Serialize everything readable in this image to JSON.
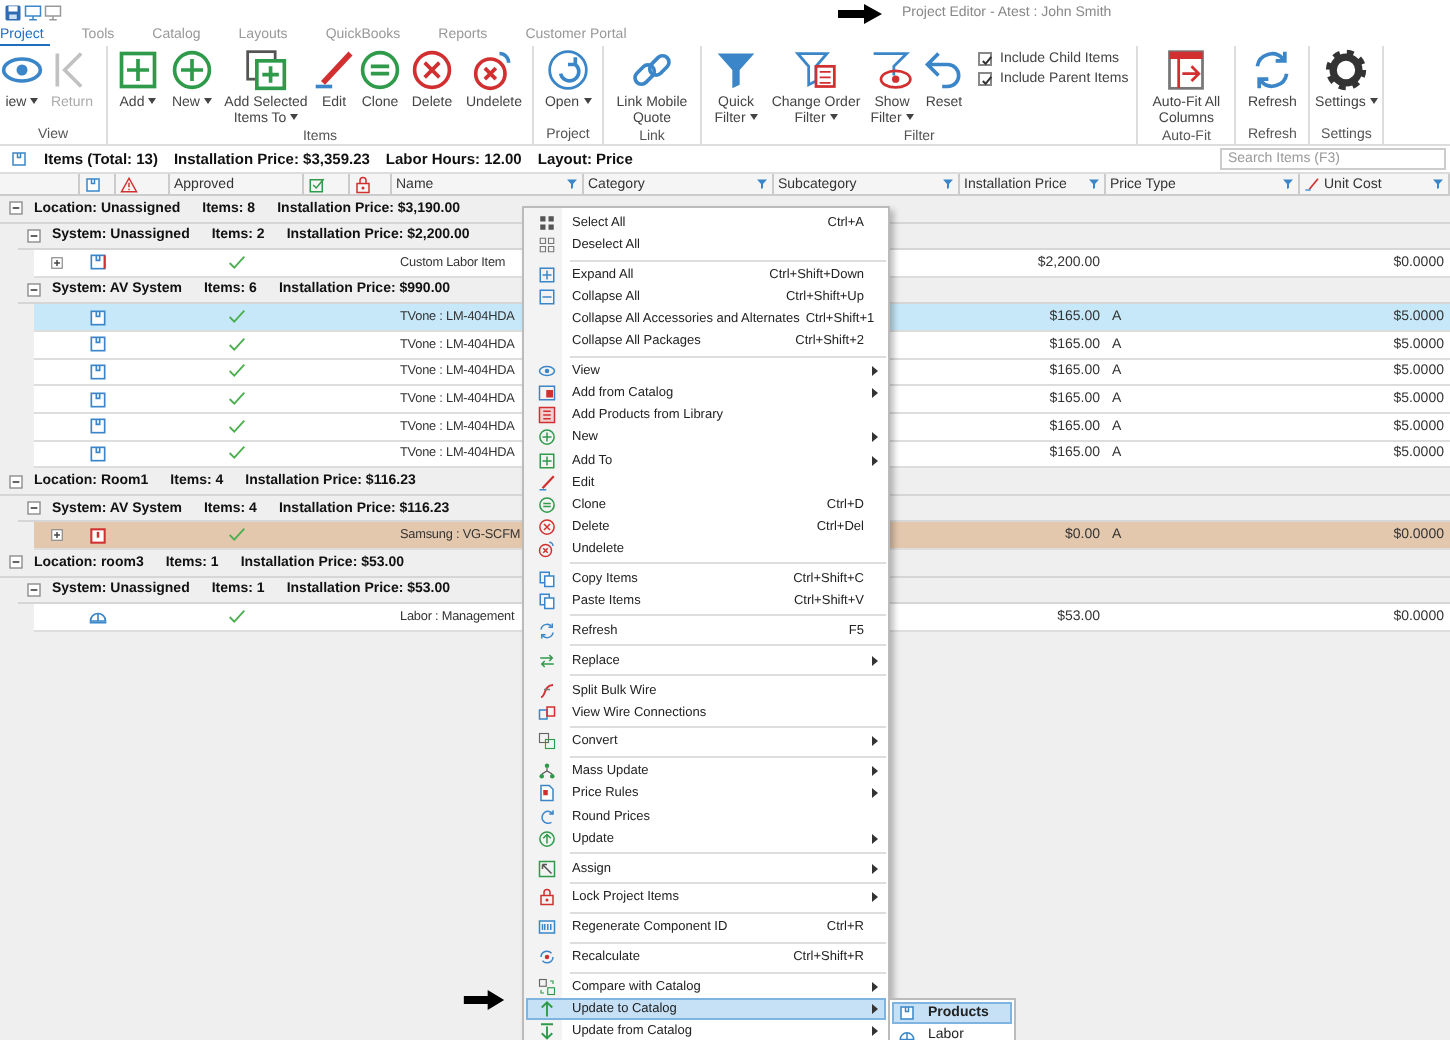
{
  "window": {
    "title": "Project Editor - Atest : John Smith"
  },
  "tabs": [
    {
      "label": "Project",
      "selected": true
    },
    {
      "label": "Tools",
      "selected": false
    },
    {
      "label": "Catalog",
      "selected": false
    },
    {
      "label": "Layouts",
      "selected": false
    },
    {
      "label": "QuickBooks",
      "selected": false
    },
    {
      "label": "Reports",
      "selected": false
    },
    {
      "label": "Customer Portal",
      "selected": false
    }
  ],
  "ribbon": {
    "groups": [
      {
        "label": "View",
        "buttons": [
          {
            "label": "iew",
            "dropdown": true,
            "disabled": false
          },
          {
            "label": "Return",
            "dropdown": false,
            "disabled": true
          }
        ]
      },
      {
        "label": "Items",
        "buttons": [
          {
            "label": "Add",
            "dropdown": true,
            "disabled": false
          },
          {
            "label": "New",
            "dropdown": true,
            "disabled": false
          },
          {
            "label": "Add Selected Items To",
            "dropdown": true,
            "disabled": false
          },
          {
            "label": "Edit",
            "dropdown": false,
            "disabled": false
          },
          {
            "label": "Clone",
            "dropdown": false,
            "disabled": false
          },
          {
            "label": "Delete",
            "dropdown": false,
            "disabled": false
          },
          {
            "label": "Undelete",
            "dropdown": false,
            "disabled": false
          }
        ]
      },
      {
        "label": "Project",
        "buttons": [
          {
            "label": "Open",
            "dropdown": true,
            "disabled": false
          }
        ]
      },
      {
        "label": "Link",
        "buttons": [
          {
            "label": "Link Mobile Quote",
            "dropdown": false,
            "disabled": false
          }
        ]
      },
      {
        "label": "Filter",
        "buttons": [
          {
            "label": "Quick Filter",
            "dropdown": true,
            "disabled": false
          },
          {
            "label": "Change Order Filter",
            "dropdown": true,
            "disabled": false
          },
          {
            "label": "Show Filter",
            "dropdown": true,
            "disabled": false
          },
          {
            "label": "Reset",
            "dropdown": false,
            "disabled": false
          }
        ],
        "checkboxes": [
          {
            "label": "Include Child Items",
            "checked": true
          },
          {
            "label": "Include Parent Items",
            "checked": true
          }
        ]
      },
      {
        "label": "Auto-Fit",
        "buttons": [
          {
            "label": "Auto-Fit All Columns",
            "dropdown": false,
            "disabled": false
          }
        ]
      },
      {
        "label": "Refresh",
        "buttons": [
          {
            "label": "Refresh",
            "dropdown": false,
            "disabled": false
          }
        ]
      },
      {
        "label": "Settings",
        "buttons": [
          {
            "label": "Settings",
            "dropdown": true,
            "disabled": false
          }
        ]
      }
    ]
  },
  "summary": {
    "items": [
      "Items (Total: 13)",
      "Installation Price: $3,359.23",
      "Labor Hours: 12.00",
      "Layout: Price"
    ],
    "search": {
      "placeholder": "Search Items (F3)"
    }
  },
  "grid": {
    "columns": [
      {
        "label": "Approved",
        "filter": false
      },
      {
        "label": "Name",
        "filter": true
      },
      {
        "label": "Category",
        "filter": true
      },
      {
        "label": "Subcategory",
        "filter": true
      },
      {
        "label": "Installation Price",
        "filter": true
      },
      {
        "label": "Price Type",
        "filter": true
      },
      {
        "label": "Unit Cost",
        "filter": true
      }
    ],
    "locations": [
      {
        "label": "Location: Unassigned",
        "items": "Items: 8",
        "price": "Installation Price: $3,190.00",
        "expanded": true,
        "systems": [
          {
            "label": "System: Unassigned",
            "items": "Items: 2",
            "price": "Installation Price: $2,200.00",
            "expanded": true,
            "rows": [
              {
                "kind": "custom",
                "expandable": true,
                "approved": true,
                "name": "Custom Labor Item",
                "installation_price": "$2,200.00",
                "unit_cost": "$0.0000",
                "selected": false,
                "highlighted": false
              }
            ]
          },
          {
            "label": "System: AV System",
            "items": "Items: 6",
            "price": "Installation Price: $990.00",
            "expanded": true,
            "rows": [
              {
                "kind": "product",
                "expandable": false,
                "approved": true,
                "name": "TVone : LM-404HDA",
                "installation_price": "$165.00",
                "price_type": "A",
                "unit_cost": "$5.0000",
                "selected": true,
                "highlighted": false
              },
              {
                "kind": "product",
                "expandable": false,
                "approved": true,
                "name": "TVone : LM-404HDA",
                "installation_price": "$165.00",
                "price_type": "A",
                "unit_cost": "$5.0000",
                "selected": false,
                "highlighted": false
              },
              {
                "kind": "product",
                "expandable": false,
                "approved": true,
                "name": "TVone : LM-404HDA",
                "installation_price": "$165.00",
                "price_type": "A",
                "unit_cost": "$5.0000",
                "selected": false,
                "highlighted": false
              },
              {
                "kind": "product",
                "expandable": false,
                "approved": true,
                "name": "TVone : LM-404HDA",
                "installation_price": "$165.00",
                "price_type": "A",
                "unit_cost": "$5.0000",
                "selected": false,
                "highlighted": false
              },
              {
                "kind": "product",
                "expandable": false,
                "approved": true,
                "name": "TVone : LM-404HDA",
                "installation_price": "$165.00",
                "price_type": "A",
                "unit_cost": "$5.0000",
                "selected": false,
                "highlighted": false
              },
              {
                "kind": "product",
                "expandable": false,
                "approved": true,
                "name": "TVone : LM-404HDA",
                "installation_price": "$165.00",
                "price_type": "A",
                "unit_cost": "$5.0000",
                "selected": false,
                "highlighted": false
              }
            ]
          }
        ]
      },
      {
        "label": "Location: Room1",
        "items": "Items: 4",
        "price": "Installation Price: $116.23",
        "expanded": true,
        "systems": [
          {
            "label": "System: AV System",
            "items": "Items: 4",
            "price": "Installation Price: $116.23",
            "expanded": true,
            "rows": [
              {
                "kind": "alert",
                "expandable": true,
                "approved": true,
                "name": "Samsung : VG-SCFM",
                "installation_price": "$0.00",
                "price_type": "A",
                "unit_cost": "$0.0000",
                "selected": false,
                "highlighted": true
              }
            ]
          }
        ]
      },
      {
        "label": "Location: room3",
        "items": "Items: 1",
        "price": "Installation Price: $53.00",
        "expanded": true,
        "systems": [
          {
            "label": "System: Unassigned",
            "items": "Items: 1",
            "price": "Installation Price: $53.00",
            "expanded": true,
            "rows": [
              {
                "kind": "labor",
                "expandable": false,
                "approved": true,
                "name": "Labor : Management",
                "installation_price": "$53.00",
                "unit_cost": "$0.0000",
                "selected": false,
                "highlighted": false
              }
            ]
          }
        ]
      }
    ]
  },
  "context_menu": {
    "sections": [
      [
        {
          "label": "Select All",
          "shortcut": "Ctrl+A",
          "submenu": false,
          "selected": false
        },
        {
          "label": "Deselect All",
          "submenu": false,
          "selected": false
        }
      ],
      [
        {
          "label": "Expand All",
          "shortcut": "Ctrl+Shift+Down",
          "submenu": false,
          "selected": false
        },
        {
          "label": "Collapse All",
          "shortcut": "Ctrl+Shift+Up",
          "submenu": false,
          "selected": false
        },
        {
          "label": "Collapse All Accessories and Alternates",
          "shortcut": "Ctrl+Shift+1",
          "submenu": false,
          "selected": false
        },
        {
          "label": "Collapse All Packages",
          "shortcut": "Ctrl+Shift+2",
          "submenu": false,
          "selected": false
        }
      ],
      [
        {
          "label": "View",
          "submenu": true,
          "selected": false
        },
        {
          "label": "Add from Catalog",
          "submenu": true,
          "selected": false
        },
        {
          "label": "Add Products from Library",
          "submenu": false,
          "selected": false
        },
        {
          "label": "New",
          "submenu": true,
          "selected": false
        },
        {
          "label": "Add To",
          "submenu": true,
          "selected": false
        },
        {
          "label": "Edit",
          "submenu": false,
          "selected": false
        },
        {
          "label": "Clone",
          "shortcut": "Ctrl+D",
          "submenu": false,
          "selected": false
        },
        {
          "label": "Delete",
          "shortcut": "Ctrl+Del",
          "submenu": false,
          "selected": false
        },
        {
          "label": "Undelete",
          "submenu": false,
          "selected": false
        }
      ],
      [
        {
          "label": "Copy Items",
          "shortcut": "Ctrl+Shift+C",
          "submenu": false,
          "selected": false
        },
        {
          "label": "Paste Items",
          "shortcut": "Ctrl+Shift+V",
          "submenu": false,
          "selected": false
        }
      ],
      [
        {
          "label": "Refresh",
          "shortcut": "F5",
          "submenu": false,
          "selected": false
        }
      ],
      [
        {
          "label": "Replace",
          "submenu": true,
          "selected": false
        }
      ],
      [
        {
          "label": "Split Bulk Wire",
          "submenu": false,
          "selected": false
        },
        {
          "label": "View Wire Connections",
          "submenu": false,
          "selected": false
        }
      ],
      [
        {
          "label": "Convert",
          "submenu": true,
          "selected": false
        }
      ],
      [
        {
          "label": "Mass Update",
          "submenu": true,
          "selected": false
        },
        {
          "label": "Price Rules",
          "submenu": true,
          "selected": false
        },
        {
          "label": "Round Prices",
          "submenu": false,
          "selected": false
        },
        {
          "label": "Update",
          "submenu": true,
          "selected": false
        }
      ],
      [
        {
          "label": "Assign",
          "submenu": true,
          "selected": false
        }
      ],
      [
        {
          "label": "Lock Project Items",
          "submenu": true,
          "selected": false
        }
      ],
      [
        {
          "label": "Regenerate Component ID",
          "shortcut": "Ctrl+R",
          "submenu": false,
          "selected": false
        }
      ],
      [
        {
          "label": "Recalculate",
          "shortcut": "Ctrl+Shift+R",
          "submenu": false,
          "selected": false
        }
      ],
      [
        {
          "label": "Compare with Catalog",
          "submenu": true,
          "selected": false
        },
        {
          "label": "Update to Catalog",
          "submenu": true,
          "selected": true
        },
        {
          "label": "Update from Catalog",
          "submenu": true,
          "selected": false
        }
      ]
    ],
    "submenu": [
      {
        "label": "Products",
        "selected": true
      },
      {
        "label": "Labor",
        "selected": false
      }
    ]
  }
}
